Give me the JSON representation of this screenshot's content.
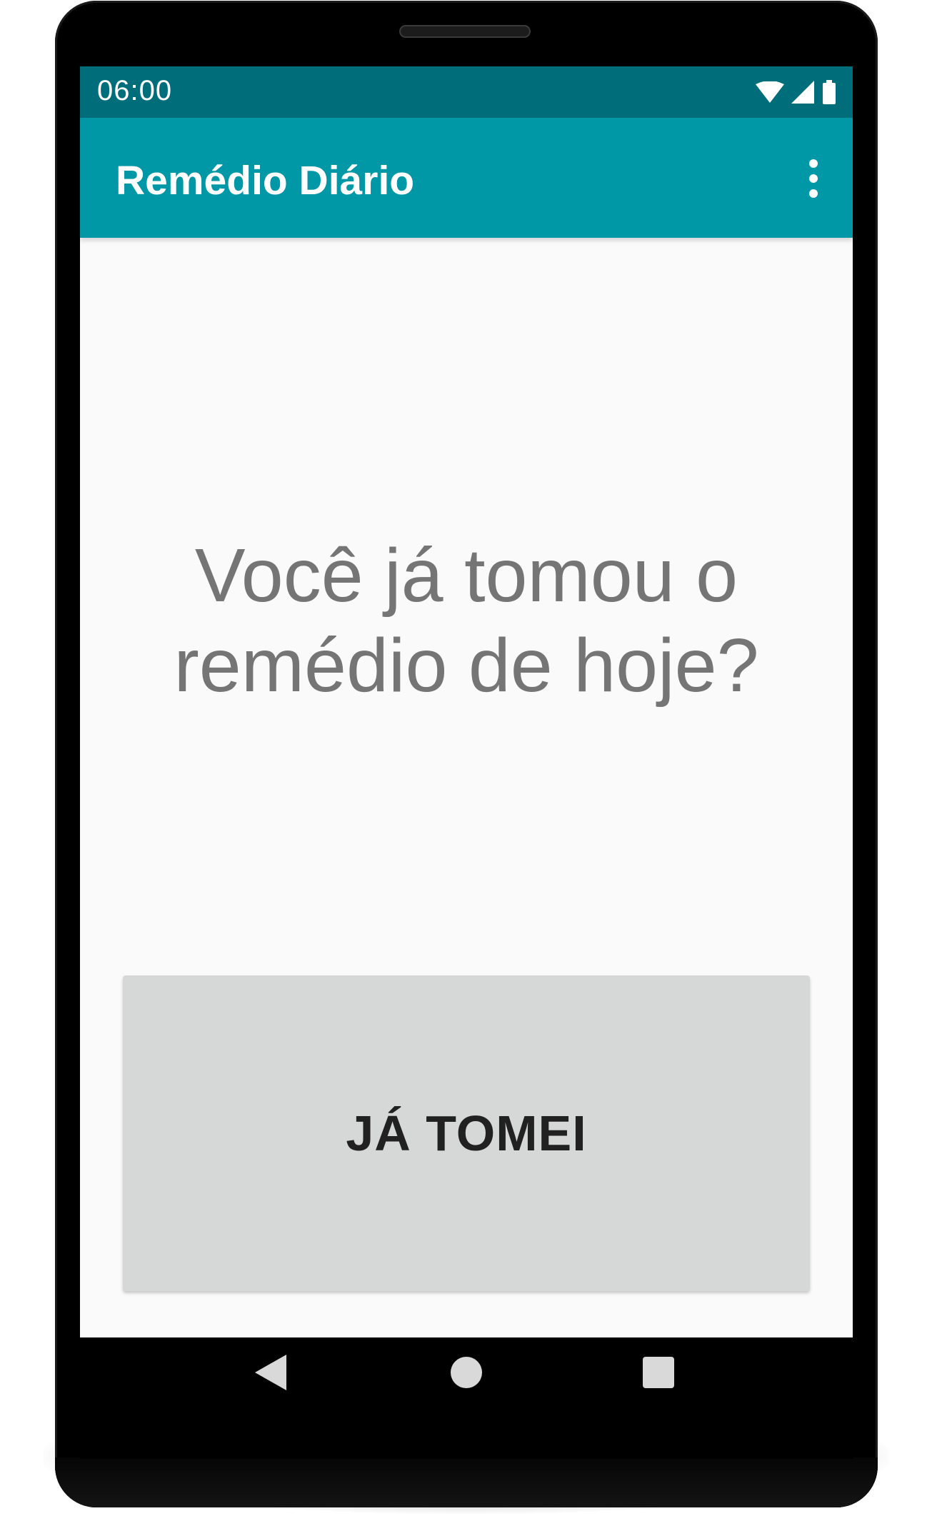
{
  "status_bar": {
    "time": "06:00",
    "icons": [
      "wifi-icon",
      "cell-signal-icon",
      "battery-icon"
    ]
  },
  "app_bar": {
    "title": "Remédio Diário",
    "overflow_icon": "more-vert-icon"
  },
  "main": {
    "question_line1": "Você já tomou o",
    "question_line2": "remédio de hoje?",
    "button_label": "JÁ TOMEI"
  },
  "nav_bar": {
    "icons": [
      "back-icon",
      "home-icon",
      "recents-icon"
    ]
  },
  "colors": {
    "status_bar": "#006d7a",
    "app_bar": "#0097a7",
    "background": "#fafafa",
    "question_text": "#757575",
    "button_bg": "#d6d7d7",
    "button_text": "#212121"
  }
}
